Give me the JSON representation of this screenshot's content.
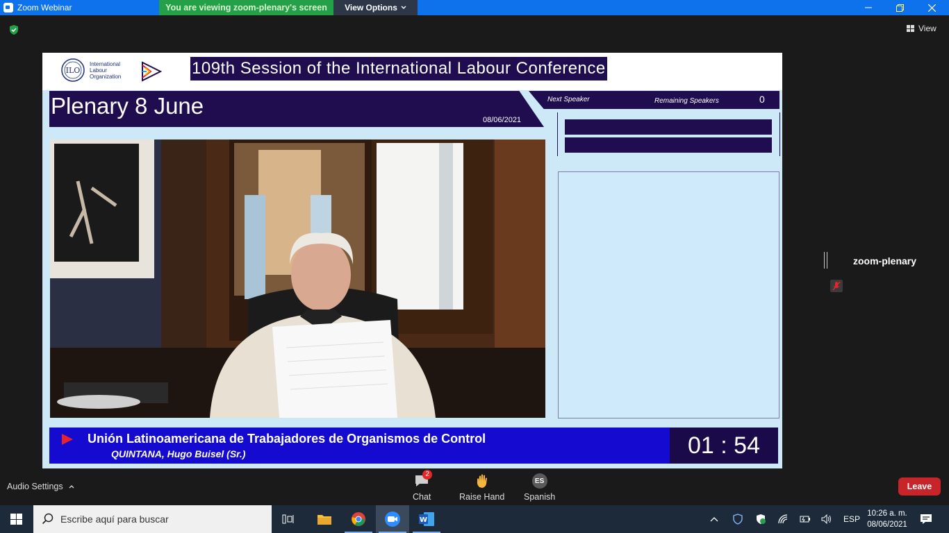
{
  "window": {
    "title": "Zoom Webinar",
    "viewing_banner": "You are viewing zoom-plenary's screen",
    "view_options": "View Options"
  },
  "top_bar": {
    "view_label": "View"
  },
  "shared_screen": {
    "org_text": [
      "International",
      "Labour",
      "Organization"
    ],
    "conference_title": "109th Session of the International Labour Conference",
    "plenary_title": "Plenary 8 June",
    "date": "08/06/2021",
    "next_speaker_label": "Next Speaker",
    "remaining_speakers_label": "Remaining Speakers",
    "remaining_speakers_count": "0",
    "organization_name": "Unión Latinoamericana de Trabajadores de Organismos de Control",
    "speaker_name": "QUINTANA, Hugo Buisel (Sr.)",
    "timer": "01 : 54"
  },
  "participant": {
    "name": "zoom-plenary"
  },
  "controls": {
    "audio_settings": "Audio Settings",
    "chat_label": "Chat",
    "chat_badge": "2",
    "raise_hand_label": "Raise Hand",
    "language_code": "ES",
    "language_label": "Spanish",
    "leave_label": "Leave"
  },
  "taskbar": {
    "search_placeholder": "Escribe aquí para buscar",
    "input_language": "ESP",
    "time": "10:26 a. m.",
    "date": "08/06/2021"
  },
  "colors": {
    "title_bar": "#0e72ed",
    "viewing_banner": "#24a148",
    "conference_navy": "#1f0d4f",
    "lower_third_blue": "#150ad0",
    "leave_red": "#c8252a"
  }
}
